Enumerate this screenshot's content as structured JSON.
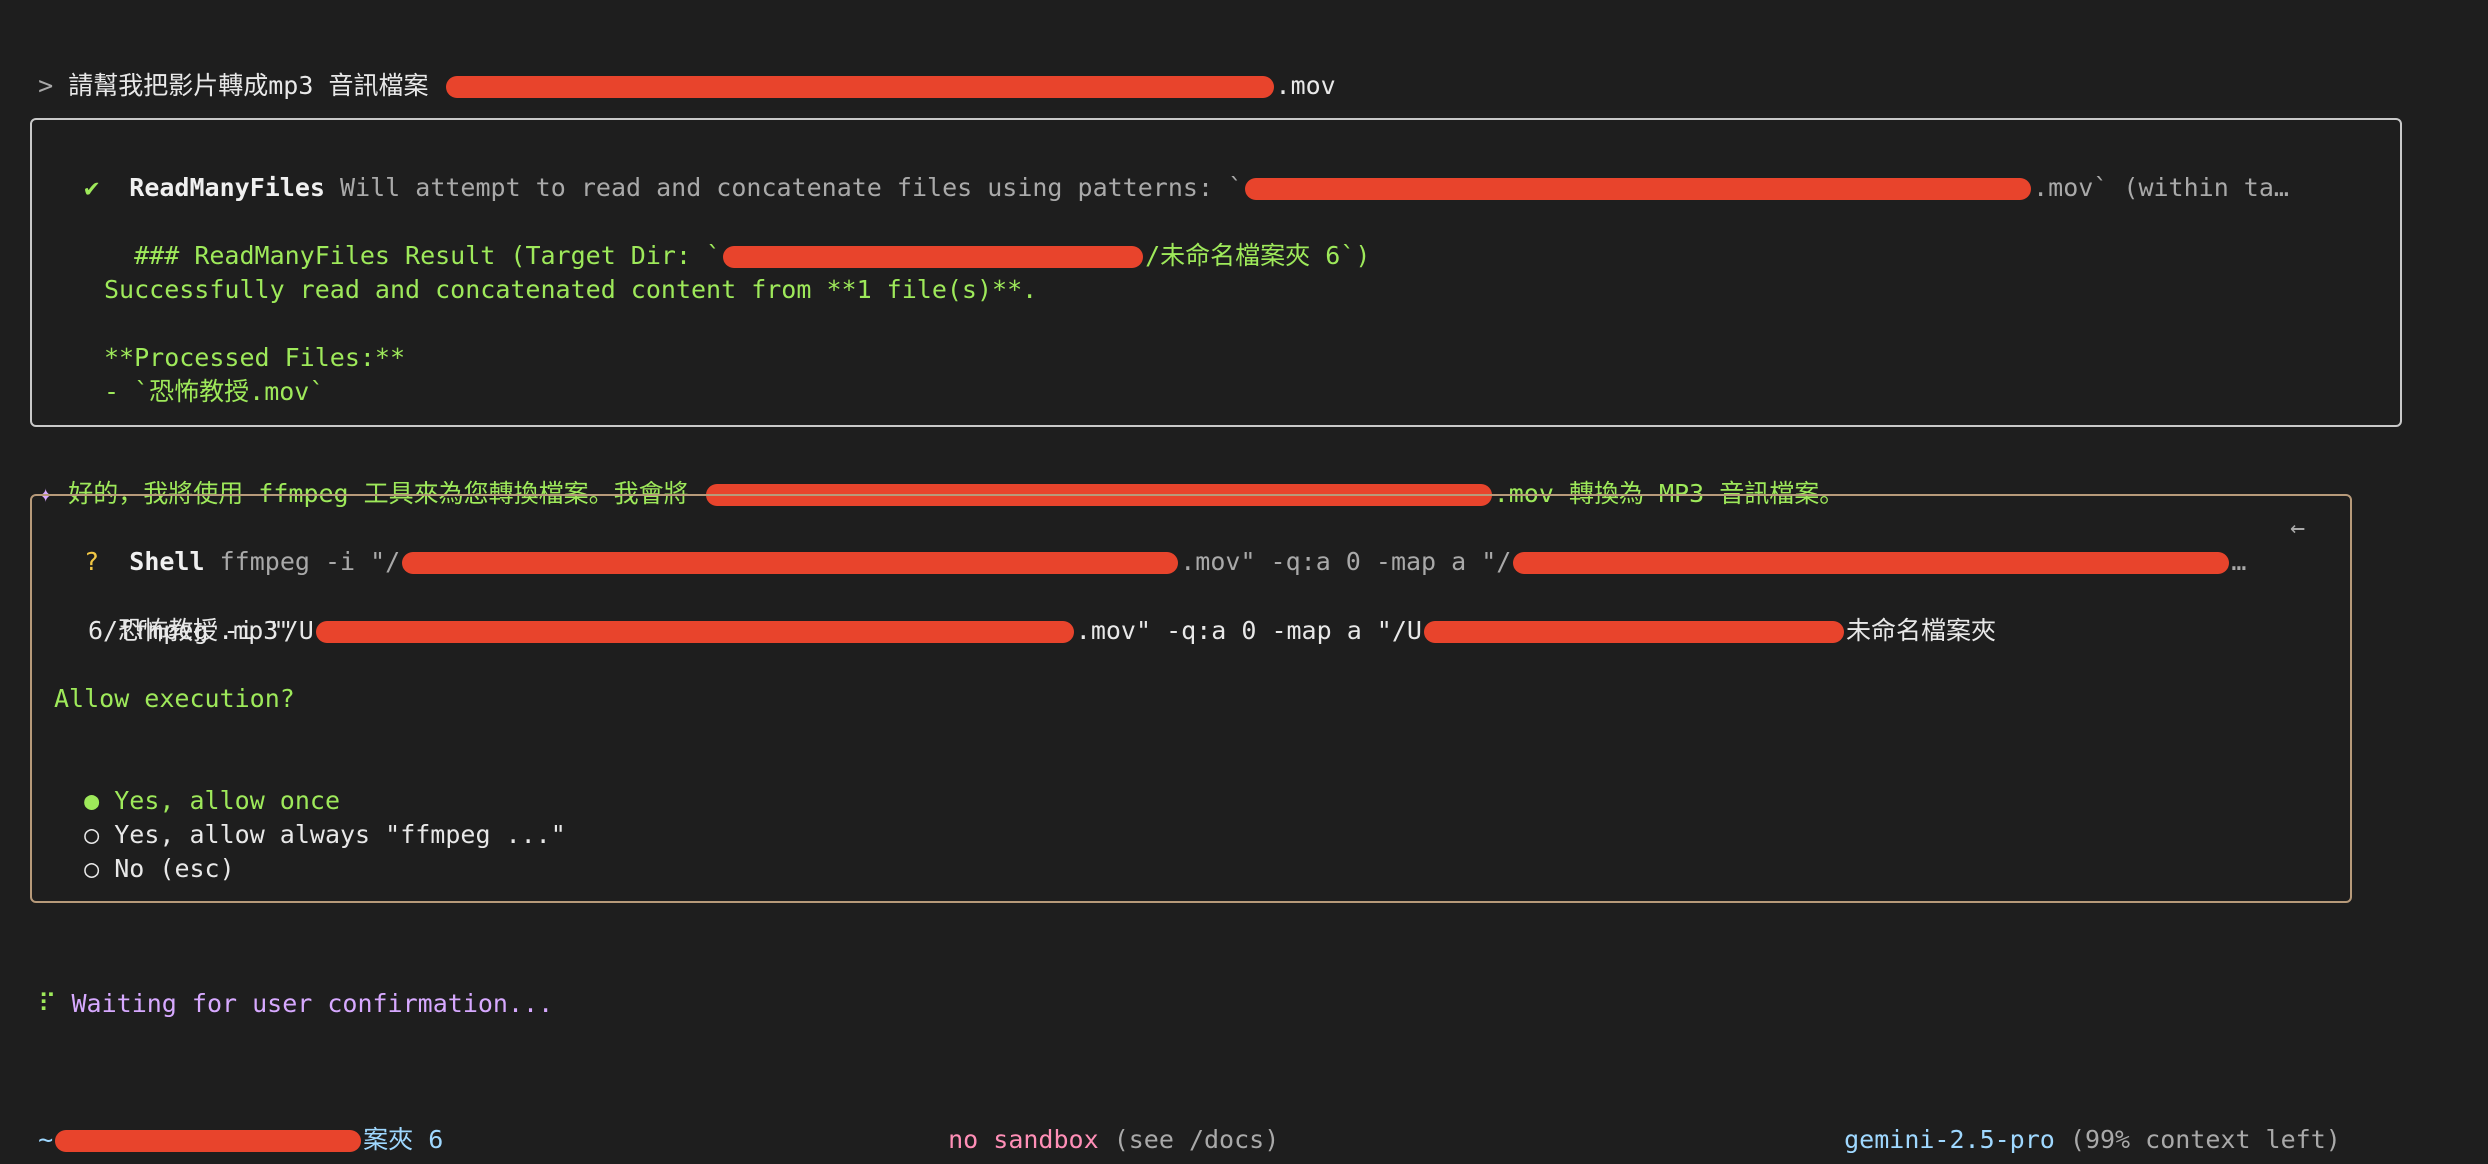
{
  "prompt": {
    "marker": ">",
    "text": "請幫我把影片轉成mp3 音訊檔案",
    "suffix": ".mov"
  },
  "readmany": {
    "check_icon": "✔",
    "title": "ReadManyFiles",
    "desc_prefix": "Will attempt to read and concatenate files using patterns: `",
    "desc_suffix": ".mov` (within ta…",
    "result_prefix": "### ReadManyFiles Result (Target Dir: `",
    "result_suffix": "/未命名檔案夾 6`)",
    "success": "Successfully read and concatenated content from **1 file(s)**.",
    "processed_label": "**Processed Files:**",
    "processed_file": "- `恐怖教授.mov`"
  },
  "assistant": {
    "marker": "✦",
    "prefix": "好的，我將使用 ffmpeg 工具來為您轉換檔案。我會將 ",
    "suffix": ".mov 轉換為 MP3 音訊檔案。"
  },
  "shell": {
    "question_icon": "?",
    "title": "Shell",
    "cmd_prefix": "ffmpeg -i \"/",
    "cmd_mid": ".mov\" -q:a 0 -map a \"/",
    "cmd_ellipsis": "…",
    "arrow_icon": "←",
    "full_line1_prefix": "ffmpeg -i \"/U",
    "full_line1_mid": ".mov\" -q:a 0 -map a \"/U",
    "full_line1_suffix": "未命名檔案夾",
    "full_line2": "6/恐怖教授.mp3\"",
    "allow_question": "Allow execution?",
    "options": [
      {
        "radio": "●",
        "label": "Yes, allow once"
      },
      {
        "radio": "○",
        "label": "Yes, allow always \"ffmpeg ...\""
      },
      {
        "radio": "○",
        "label": "No (esc)"
      }
    ]
  },
  "waiting": {
    "spinner": "⠏",
    "text": "Waiting for user confirmation..."
  },
  "footer": {
    "cwd_prefix": "~",
    "cwd_suffix": "案夾 6",
    "sandbox": "no sandbox",
    "sandbox_hint": "(see /docs)",
    "model": "gemini-2.5-pro",
    "context": "(99% context left)"
  },
  "colors": {
    "background": "#1e1e1e",
    "success_green": "#9ee95a",
    "box_border_done": "#c9c9c9",
    "box_border_pending": "#b79a7a",
    "redaction": "#e8442c"
  }
}
